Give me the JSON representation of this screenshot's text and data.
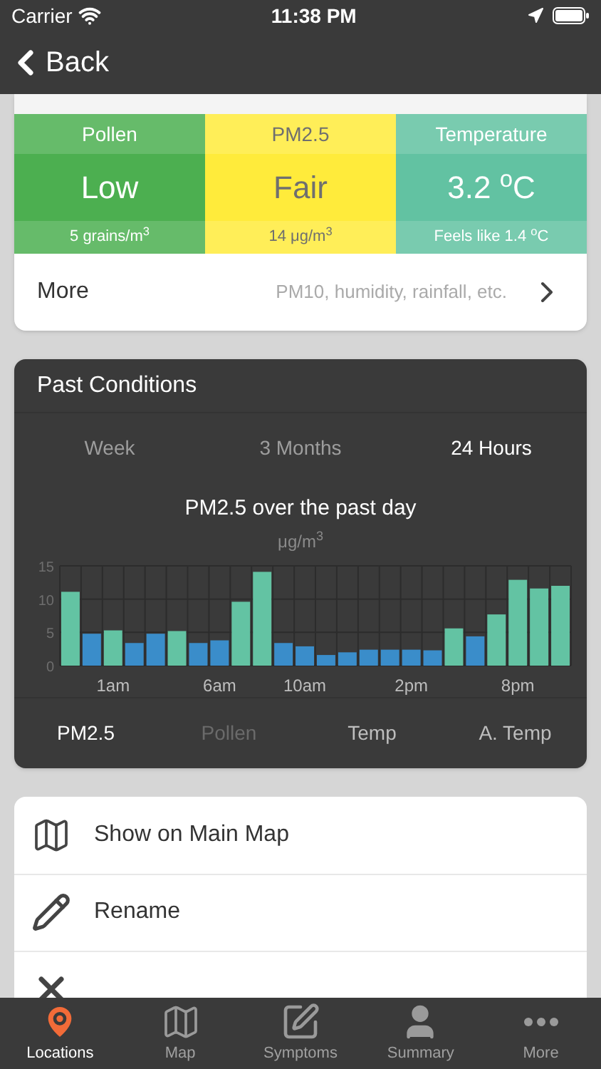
{
  "status_bar": {
    "carrier": "Carrier",
    "time": "11:38 PM"
  },
  "nav": {
    "back_label": "Back"
  },
  "current_conditions": {
    "cells": [
      {
        "label": "Pollen",
        "value": "Low",
        "detail": "5 grains/m$^{3}$",
        "color": "#4caf50",
        "kind": "light"
      },
      {
        "label": "PM2.5",
        "value": "Fair",
        "detail": "14 μg/m$^{3}$",
        "color": "#ffeb3b",
        "kind": "dark"
      },
      {
        "label": "Temperature",
        "value": "3.2 $^{o}$C",
        "detail": "Feels like 1.4 $^{o}$C",
        "color": "#62c2a2",
        "kind": "light"
      }
    ],
    "more": {
      "label": "More",
      "hint": "PM10, humidity, rainfall, etc."
    }
  },
  "past_conditions": {
    "title": "Past Conditions",
    "ranges": [
      {
        "label": "Week",
        "selected": false
      },
      {
        "label": "3 Months",
        "selected": false
      },
      {
        "label": "24 Hours",
        "selected": true
      }
    ],
    "chart_title": "PM2.5 over the past day",
    "unit": "μg/m$^{3}$",
    "chart_data": {
      "type": "bar",
      "stacked": true,
      "ylim": [
        0,
        15
      ],
      "yticks": [
        0,
        5,
        10,
        15
      ],
      "categories": [
        null,
        null,
        "1am",
        null,
        null,
        null,
        null,
        "6am",
        null,
        null,
        null,
        "10am",
        null,
        null,
        null,
        null,
        "2pm",
        null,
        null,
        null,
        null,
        "8pm",
        null,
        null
      ],
      "series": [
        {
          "color": "#63c3a3",
          "values": [
            11.1,
            null,
            5.3,
            null,
            null,
            5.2,
            null,
            null,
            9.6,
            14.1,
            null,
            null,
            null,
            null,
            null,
            null,
            null,
            null,
            5.6,
            null,
            7.7,
            12.9,
            11.6,
            12.0
          ]
        },
        {
          "color": "#3a8dca",
          "values": [
            null,
            4.8,
            null,
            3.4,
            4.8,
            null,
            3.4,
            3.8,
            null,
            null,
            3.4,
            2.9,
            1.6,
            2.0,
            2.4,
            2.4,
            2.4,
            2.3,
            null,
            4.4,
            null,
            null,
            null,
            null
          ]
        }
      ]
    },
    "metrics": [
      {
        "label": "PM2.5",
        "selected": true,
        "disabled": false
      },
      {
        "label": "Pollen",
        "selected": false,
        "disabled": true
      },
      {
        "label": "Temp",
        "selected": false,
        "disabled": false
      },
      {
        "label": "A. Temp",
        "selected": false,
        "disabled": false
      }
    ]
  },
  "actions": [
    {
      "kind": "map",
      "label": "Show on Main Map"
    },
    {
      "kind": "rename",
      "label": "Rename"
    },
    {
      "kind": "remove"
    }
  ],
  "tab_bar": [
    {
      "kind": "pin",
      "label": "Locations",
      "selected": true
    },
    {
      "kind": "map",
      "label": "Map",
      "selected": false
    },
    {
      "kind": "compose",
      "label": "Symptoms",
      "selected": false
    },
    {
      "kind": "person",
      "label": "Summary",
      "selected": false
    },
    {
      "kind": "dots",
      "label": "More",
      "selected": false
    }
  ]
}
